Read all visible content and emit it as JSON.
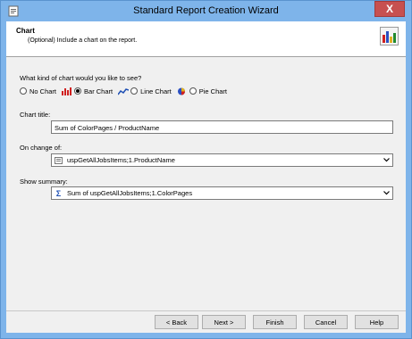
{
  "window": {
    "title": "Standard Report Creation Wizard",
    "close_glyph": "X"
  },
  "header": {
    "title": "Chart",
    "subtitle": "(Optional) Include a chart on the report.",
    "icon": "chart-icon"
  },
  "chart_type": {
    "question": "What kind of chart would you like to see?",
    "options": [
      {
        "label": "No Chart",
        "icon": "",
        "selected": false
      },
      {
        "label": "Bar Chart",
        "icon": "bar-chart-icon",
        "selected": true
      },
      {
        "label": "Line Chart",
        "icon": "line-chart-icon",
        "selected": false
      },
      {
        "label": "Pie Chart",
        "icon": "pie-chart-icon",
        "selected": false
      }
    ]
  },
  "chart_title": {
    "label": "Chart title:",
    "value": "Sum of ColorPages / ProductName"
  },
  "on_change_of": {
    "label": "On change of:",
    "value": "uspGetAllJobsItems;1.ProductName",
    "icon": "field-icon"
  },
  "show_summary": {
    "label": "Show summary:",
    "value": "Sum of uspGetAllJobsItems;1.ColorPages",
    "icon": "sigma-icon",
    "icon_glyph": "Σ"
  },
  "buttons": {
    "back": "< Back",
    "next": "Next >",
    "finish": "Finish",
    "cancel": "Cancel",
    "help": "Help"
  },
  "colors": {
    "titlebar": "#7eb4ea",
    "close": "#c75050",
    "dialog_bg": "#f0f0f0",
    "accent_blue": "#1e4fb4"
  }
}
